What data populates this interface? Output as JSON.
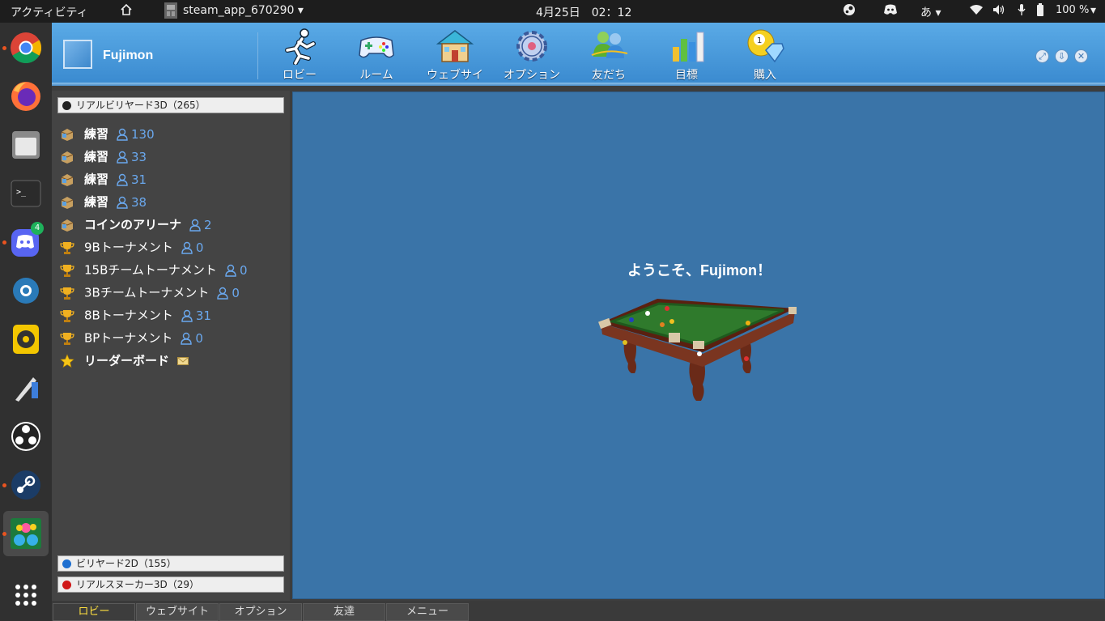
{
  "system_bar": {
    "activities": "アクティビティ",
    "app_name": "steam_app_670290",
    "datetime": "4月25日　02：12",
    "input_method": "あ",
    "battery": "100 %"
  },
  "dock": {
    "apps": [
      "chrome-icon",
      "firefox-icon",
      "files-icon",
      "terminal-icon",
      "discord-icon",
      "steam-store-icon",
      "rhythmbox-icon",
      "draw-icon",
      "obs-icon",
      "steam-icon",
      "billiards-game-icon",
      "app-grid-icon"
    ],
    "discord_badge": "4"
  },
  "header": {
    "username": "Fujimon"
  },
  "toolbar": {
    "items": [
      {
        "label": "ロビー",
        "icon": "runner-icon"
      },
      {
        "label": "ルーム",
        "icon": "gamepad-icon"
      },
      {
        "label": "ウェブサイ",
        "icon": "house-icon"
      },
      {
        "label": "オプション",
        "icon": "gear-icon"
      },
      {
        "label": "友だち",
        "icon": "friends-icon"
      },
      {
        "label": "目標",
        "icon": "bar-chart-icon"
      },
      {
        "label": "購入",
        "icon": "diamond-ball-icon"
      }
    ]
  },
  "sidebar": {
    "categories": [
      {
        "label": "リアルビリヤード3D（265）",
        "color": "#222222"
      },
      {
        "label": "ビリヤード2D（155）",
        "color": "#1e6fd0"
      },
      {
        "label": "リアルスヌーカー3D（29）",
        "color": "#d01818"
      }
    ],
    "rooms": [
      {
        "name": "練習",
        "count": "130",
        "icon": "room-box-icon"
      },
      {
        "name": "練習",
        "count": "33",
        "icon": "room-box-icon"
      },
      {
        "name": "練習",
        "count": "31",
        "icon": "room-box-icon"
      },
      {
        "name": "練習",
        "count": "38",
        "icon": "room-box-icon"
      },
      {
        "name": "コインのアリーナ",
        "count": "2",
        "icon": "room-box-icon"
      },
      {
        "name": "9Bトーナメント",
        "count": "0",
        "icon": "trophy-icon"
      },
      {
        "name": "15Bチームトーナメント",
        "count": "0",
        "icon": "trophy-icon"
      },
      {
        "name": "3Bチームトーナメント",
        "count": "0",
        "icon": "trophy-icon"
      },
      {
        "name": "8Bトーナメント",
        "count": "31",
        "icon": "trophy-icon"
      },
      {
        "name": "BPトーナメント",
        "count": "0",
        "icon": "trophy-icon"
      },
      {
        "name": "リーダーボード",
        "count": "",
        "icon": "star-icon"
      }
    ]
  },
  "main": {
    "welcome": "ようこそ、Fujimon！"
  },
  "bottom_tabs": [
    "ロビー",
    "ウェブサイト",
    "オプション",
    "友達",
    "メニュー"
  ]
}
